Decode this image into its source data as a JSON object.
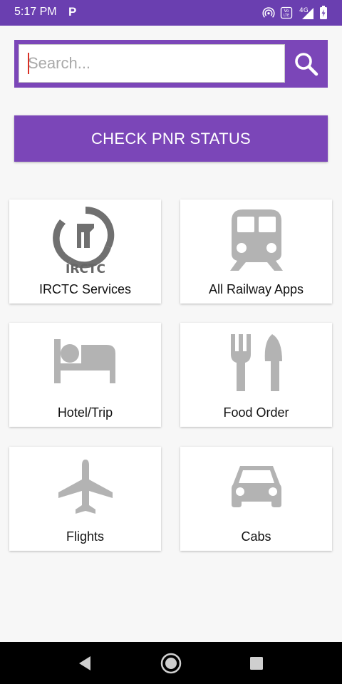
{
  "status_bar": {
    "time": "5:17 PM",
    "app_indicator": "P",
    "network_label": "4G",
    "background_color": "#6a3fb0"
  },
  "search": {
    "placeholder": "Search...",
    "value": "",
    "button_icon": "search-icon"
  },
  "pnr_button": {
    "label": "CHECK PNR STATUS",
    "color": "#7b46b8"
  },
  "tiles": [
    {
      "label": "IRCTC Services",
      "icon": "irctc-logo-icon",
      "logo_text": "IRCTC"
    },
    {
      "label": "All Railway Apps",
      "icon": "train-icon"
    },
    {
      "label": "Hotel/Trip",
      "icon": "bed-icon"
    },
    {
      "label": "Food Order",
      "icon": "fork-knife-icon"
    },
    {
      "label": "Flights",
      "icon": "airplane-icon"
    },
    {
      "label": "Cabs",
      "icon": "car-icon"
    }
  ],
  "nav_bar": {
    "buttons": [
      "back-icon",
      "home-icon",
      "recents-icon"
    ]
  }
}
